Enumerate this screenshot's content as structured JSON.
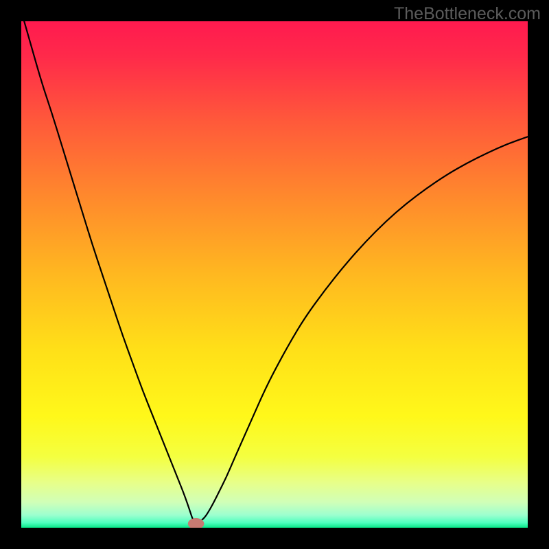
{
  "watermark": "TheBottleneck.com",
  "chart_data": {
    "type": "line",
    "title": "",
    "xlabel": "",
    "ylabel": "",
    "xlim": [
      0,
      100
    ],
    "ylim": [
      0,
      100
    ],
    "grid": false,
    "legend": false,
    "background_gradient": {
      "stops": [
        {
          "offset": 0.0,
          "color": "#ff1a4f"
        },
        {
          "offset": 0.07,
          "color": "#ff2a4a"
        },
        {
          "offset": 0.2,
          "color": "#ff5a3a"
        },
        {
          "offset": 0.35,
          "color": "#ff8a2c"
        },
        {
          "offset": 0.5,
          "color": "#ffb820"
        },
        {
          "offset": 0.65,
          "color": "#ffe018"
        },
        {
          "offset": 0.78,
          "color": "#fff81a"
        },
        {
          "offset": 0.86,
          "color": "#f4ff40"
        },
        {
          "offset": 0.91,
          "color": "#e8ff88"
        },
        {
          "offset": 0.95,
          "color": "#d0ffb8"
        },
        {
          "offset": 0.975,
          "color": "#9cffcf"
        },
        {
          "offset": 0.99,
          "color": "#4fffbf"
        },
        {
          "offset": 1.0,
          "color": "#08e688"
        }
      ]
    },
    "marker": {
      "x": 34.5,
      "y": 0.8,
      "rx": 1.6,
      "ry": 1.1,
      "color": "#c77a72"
    },
    "series": [
      {
        "name": "bottleneck-curve",
        "color": "#000000",
        "width": 2.2,
        "x": [
          0,
          2,
          4,
          6,
          8,
          10,
          12,
          14,
          16,
          18,
          20,
          22,
          24,
          26,
          28,
          30,
          31,
          32,
          32.8,
          33.4,
          33.8,
          34.2,
          34.8,
          35.4,
          36.2,
          37.0,
          38.0,
          39.0,
          40.5,
          42,
          44,
          46,
          48,
          50,
          53,
          56,
          60,
          64,
          68,
          72,
          76,
          80,
          84,
          88,
          92,
          96,
          100
        ],
        "y": [
          102,
          95,
          88,
          82,
          75.5,
          69,
          62.5,
          56,
          50,
          44,
          38,
          32.5,
          27,
          22,
          17,
          12,
          9.5,
          7,
          4.8,
          3.0,
          1.8,
          1.2,
          1.0,
          1.3,
          2.0,
          3.2,
          5.0,
          7.0,
          10.0,
          13.5,
          18.0,
          22.5,
          27.0,
          31.0,
          36.5,
          41.5,
          47.0,
          52.0,
          56.5,
          60.5,
          64.0,
          67.0,
          69.7,
          72.0,
          74.0,
          75.8,
          77.2
        ]
      }
    ]
  }
}
